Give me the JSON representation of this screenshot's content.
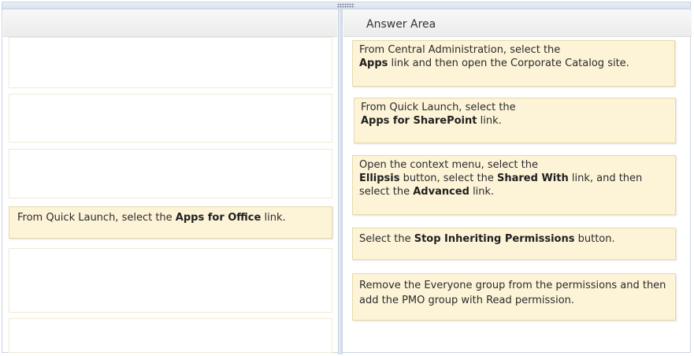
{
  "answer_area": {
    "title": "Answer Area"
  },
  "placed_item": {
    "prefix": "From Quick Launch, select the ",
    "bold": "Apps for Office",
    "suffix": " link."
  },
  "options": [
    {
      "pre": "From Central Administration, select the",
      "b1": "Apps",
      "mid": " link and then open the Corporate Catalog site.",
      "b2": "",
      "post": ""
    },
    {
      "pre": "From Quick Launch, select the",
      "b1": "Apps for SharePoint",
      "mid": " link.",
      "b2": "",
      "post": ""
    },
    {
      "pre": "Open the context menu, select the",
      "b1": "Ellipsis",
      "mid": " button, select the ",
      "b2": "Shared With",
      "post": " link, and then select the ",
      "b3": "Advanced",
      "end": " link."
    },
    {
      "pre": "Select the ",
      "b1": "Stop Inheriting Permissions",
      "mid": " button.",
      "b2": "",
      "post": ""
    },
    {
      "pre": "Remove the Everyone group from the permissions and then add the PMO group with Read permission."
    }
  ],
  "colors": {
    "option_fill": "#fdf4d8",
    "option_border": "#e6d9a9",
    "panel_border": "#c9d3de"
  }
}
